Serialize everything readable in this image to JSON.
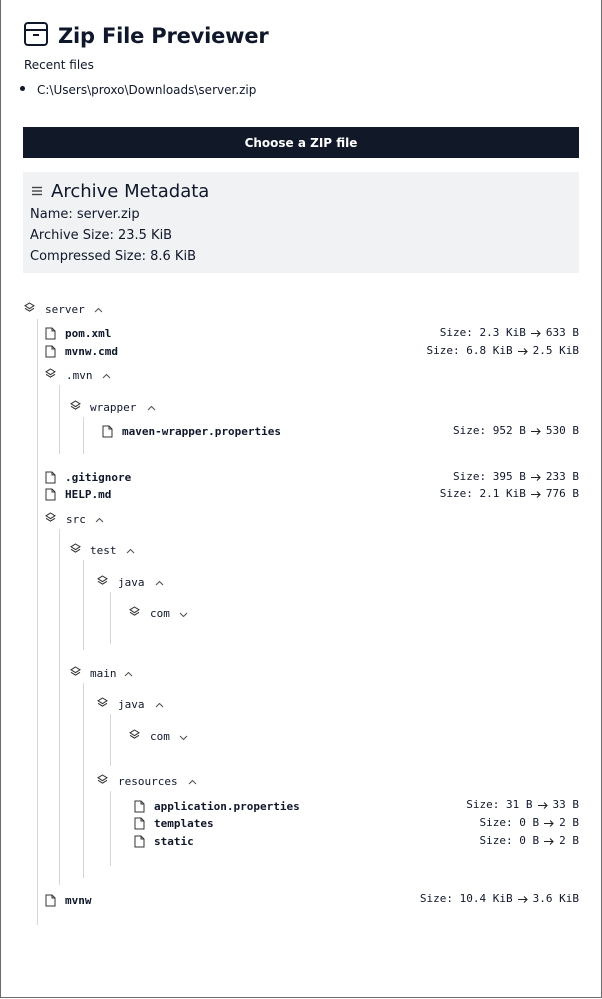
{
  "app": {
    "title": "Zip File Previewer"
  },
  "recent": {
    "label": "Recent files",
    "items": [
      "C:\\Users\\proxo\\Downloads\\server.zip"
    ]
  },
  "choose_button": "Choose a ZIP file",
  "metadata": {
    "title": "Archive Metadata",
    "name": "Name: server.zip",
    "archive_size": "Archive Size: 23.5 KiB",
    "compressed_size": "Compressed Size: 8.6 KiB"
  },
  "tree": {
    "server": "server",
    "pom": {
      "name": "pom.xml",
      "size": "Size: 2.3 KiB",
      "compressed": "633 B"
    },
    "mvnw_cmd": {
      "name": "mvnw.cmd",
      "size": "Size: 6.8 KiB",
      "compressed": "2.5 KiB"
    },
    "mvn": ".mvn",
    "wrapper": "wrapper",
    "maven_wrapper": {
      "name": "maven-wrapper.properties",
      "size": "Size: 952 B",
      "compressed": "530 B"
    },
    "gitignore": {
      "name": ".gitignore",
      "size": "Size: 395 B",
      "compressed": "233 B"
    },
    "help": {
      "name": "HELP.md",
      "size": "Size: 2.1 KiB",
      "compressed": "776 B"
    },
    "src": "src",
    "test": "test",
    "test_java": "java",
    "test_com": "com",
    "main": "main",
    "main_java": "java",
    "main_com": "com",
    "resources": "resources",
    "app_props": {
      "name": "application.properties",
      "size": "Size: 31 B",
      "compressed": "33 B"
    },
    "templates": {
      "name": "templates",
      "size": "Size: 0 B",
      "compressed": "2 B"
    },
    "static": {
      "name": "static",
      "size": "Size: 0 B",
      "compressed": "2 B"
    },
    "mvnw": {
      "name": "mvnw",
      "size": "Size: 10.4 KiB",
      "compressed": "3.6 KiB"
    }
  }
}
